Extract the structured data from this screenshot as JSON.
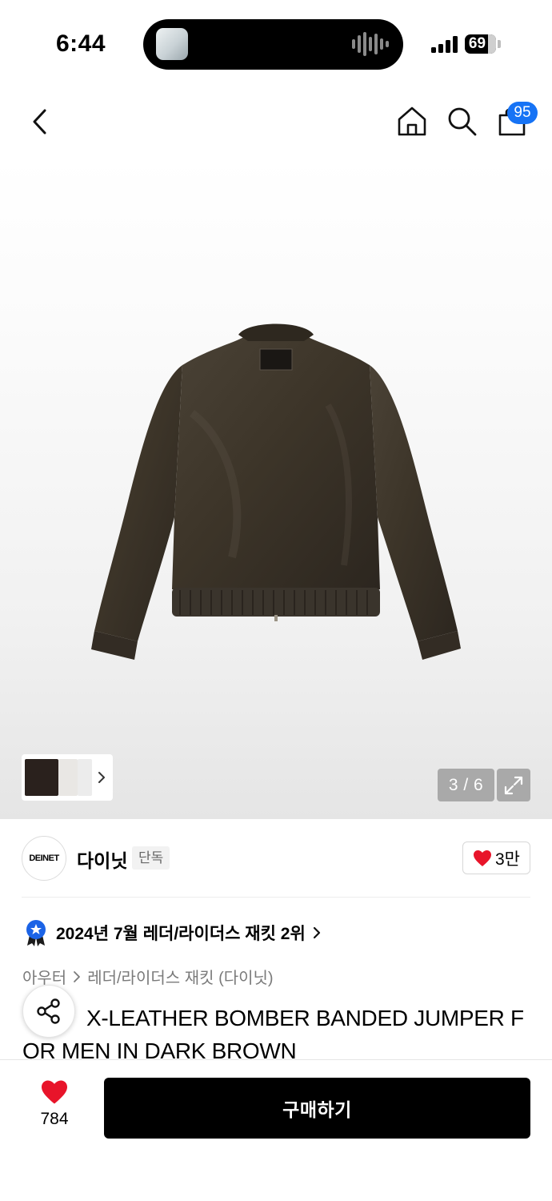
{
  "status_bar": {
    "time": "6:44",
    "battery_level": "69",
    "icons": [
      "island-thumbnail-icon",
      "audio-waveform-icon",
      "signal-icon",
      "battery-icon"
    ]
  },
  "nav": {
    "icons": [
      "back-chevron-icon",
      "home-icon",
      "search-icon",
      "shopping-bag-icon"
    ],
    "cart_badge": "95",
    "accent_color": "#1673f5"
  },
  "gallery": {
    "indicator": "3 / 6",
    "current": 3,
    "total": 6,
    "icons": [
      "thumbnail-more-chevron-icon",
      "expand-icon"
    ]
  },
  "brand": {
    "logo_text": "DEINET",
    "name": "다이닛",
    "exclusive_badge": "단독",
    "like_count": "3만",
    "heart_color": "#e8142a"
  },
  "ranking": {
    "text": "2024년 7월 레더/라이더스 재킷 2위",
    "icons": [
      "ranking-medal-icon",
      "chevron-right-icon"
    ],
    "medal_color": "#1b63e6"
  },
  "breadcrumb": {
    "category": "아우터",
    "subcategory": "레더/라이더스 재킷 (다이닛)"
  },
  "product": {
    "title_visible": "X-LEATHER BOMBER BANDED JUMPER FOR MEN IN DARK BROWN"
  },
  "bottom_bar": {
    "wish_count": "784",
    "buy_label": "구매하기",
    "icons": [
      "share-icon",
      "heart-icon"
    ]
  }
}
